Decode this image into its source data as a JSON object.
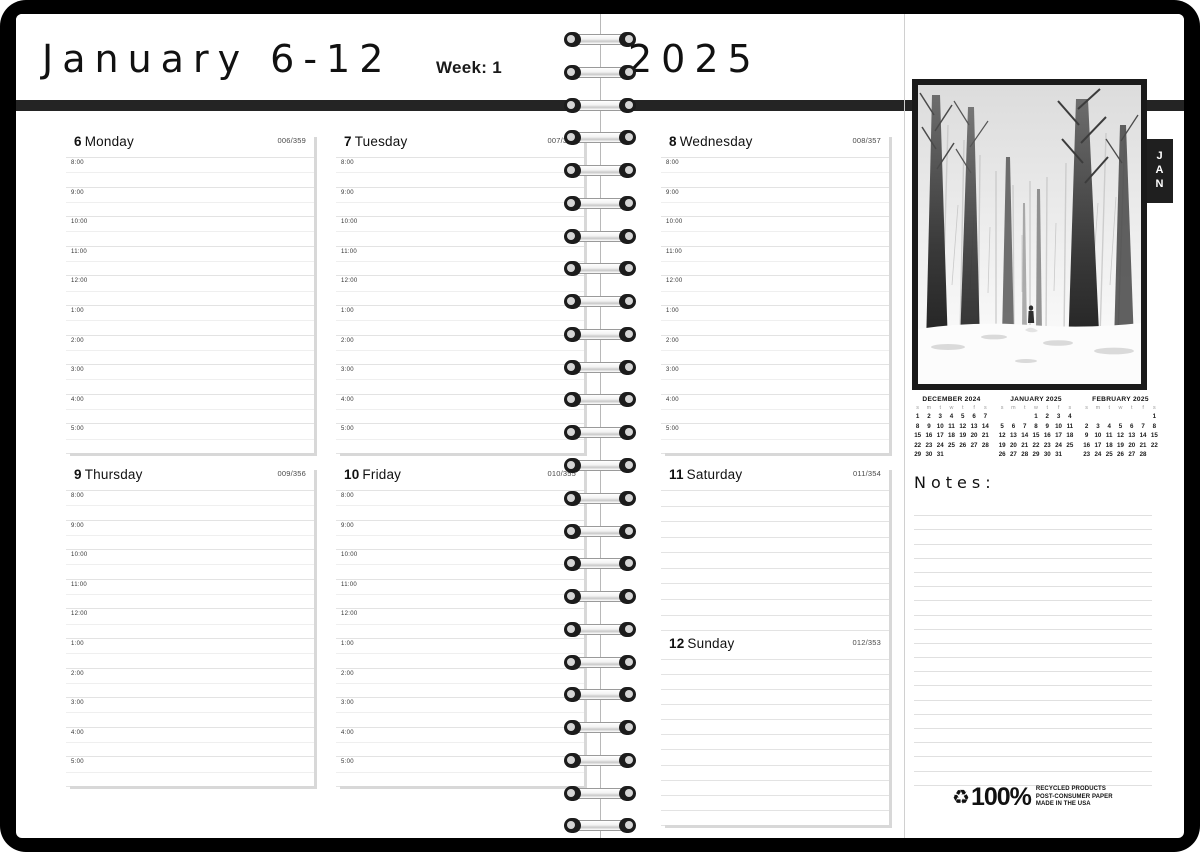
{
  "header": {
    "month_range": "January 6-12",
    "week_label": "Week: 1",
    "year": "2025"
  },
  "days": [
    {
      "num": "6",
      "name": "Monday",
      "count": "006/359",
      "type": "timed",
      "col": 0,
      "row": 0
    },
    {
      "num": "7",
      "name": "Tuesday",
      "count": "007/358",
      "type": "timed",
      "col": 1,
      "row": 0
    },
    {
      "num": "8",
      "name": "Wednesday",
      "count": "008/357",
      "type": "timed",
      "col": 2,
      "row": 0
    },
    {
      "num": "9",
      "name": "Thursday",
      "count": "009/356",
      "type": "timed",
      "col": 0,
      "row": 1
    },
    {
      "num": "10",
      "name": "Friday",
      "count": "010/355",
      "type": "timed",
      "col": 1,
      "row": 1
    },
    {
      "num": "11",
      "name": "Saturday",
      "count": "011/354",
      "type": "ruled",
      "col": 2,
      "row": 1
    },
    {
      "num": "12",
      "name": "Sunday",
      "count": "012/353",
      "type": "ruled",
      "col": 2,
      "row": 2
    }
  ],
  "time_slots": [
    "8:00",
    "9:00",
    "10:00",
    "11:00",
    "12:00",
    "1:00",
    "2:00",
    "3:00",
    "4:00",
    "5:00"
  ],
  "sidebar": {
    "month_tab": "JAN",
    "notes_title": "Notes:",
    "notes_line_count": 20,
    "photo_alt": "winter-forest-photo"
  },
  "mini_calendars": [
    {
      "title": "December 2024",
      "dow": [
        "s",
        "m",
        "t",
        "w",
        "t",
        "f",
        "s"
      ],
      "lead_blanks": 0,
      "days": 31
    },
    {
      "title": "January 2025",
      "dow": [
        "s",
        "m",
        "t",
        "w",
        "t",
        "f",
        "s"
      ],
      "lead_blanks": 3,
      "days": 31
    },
    {
      "title": "February 2025",
      "dow": [
        "s",
        "m",
        "t",
        "w",
        "t",
        "f",
        "s"
      ],
      "lead_blanks": 6,
      "days": 28
    }
  ],
  "footer": {
    "recycle_symbol": "♻",
    "percent": "100%",
    "line1": "RECYCLED PRODUCTS",
    "line2": "POST-CONSUMER PAPER",
    "line3": "MADE IN THE USA"
  },
  "spiral": {
    "ring_count": 25
  },
  "colors": {
    "ink": "#111111",
    "rule": "#e3e3e3",
    "band": "#242424",
    "tab": "#1f1f1f"
  }
}
